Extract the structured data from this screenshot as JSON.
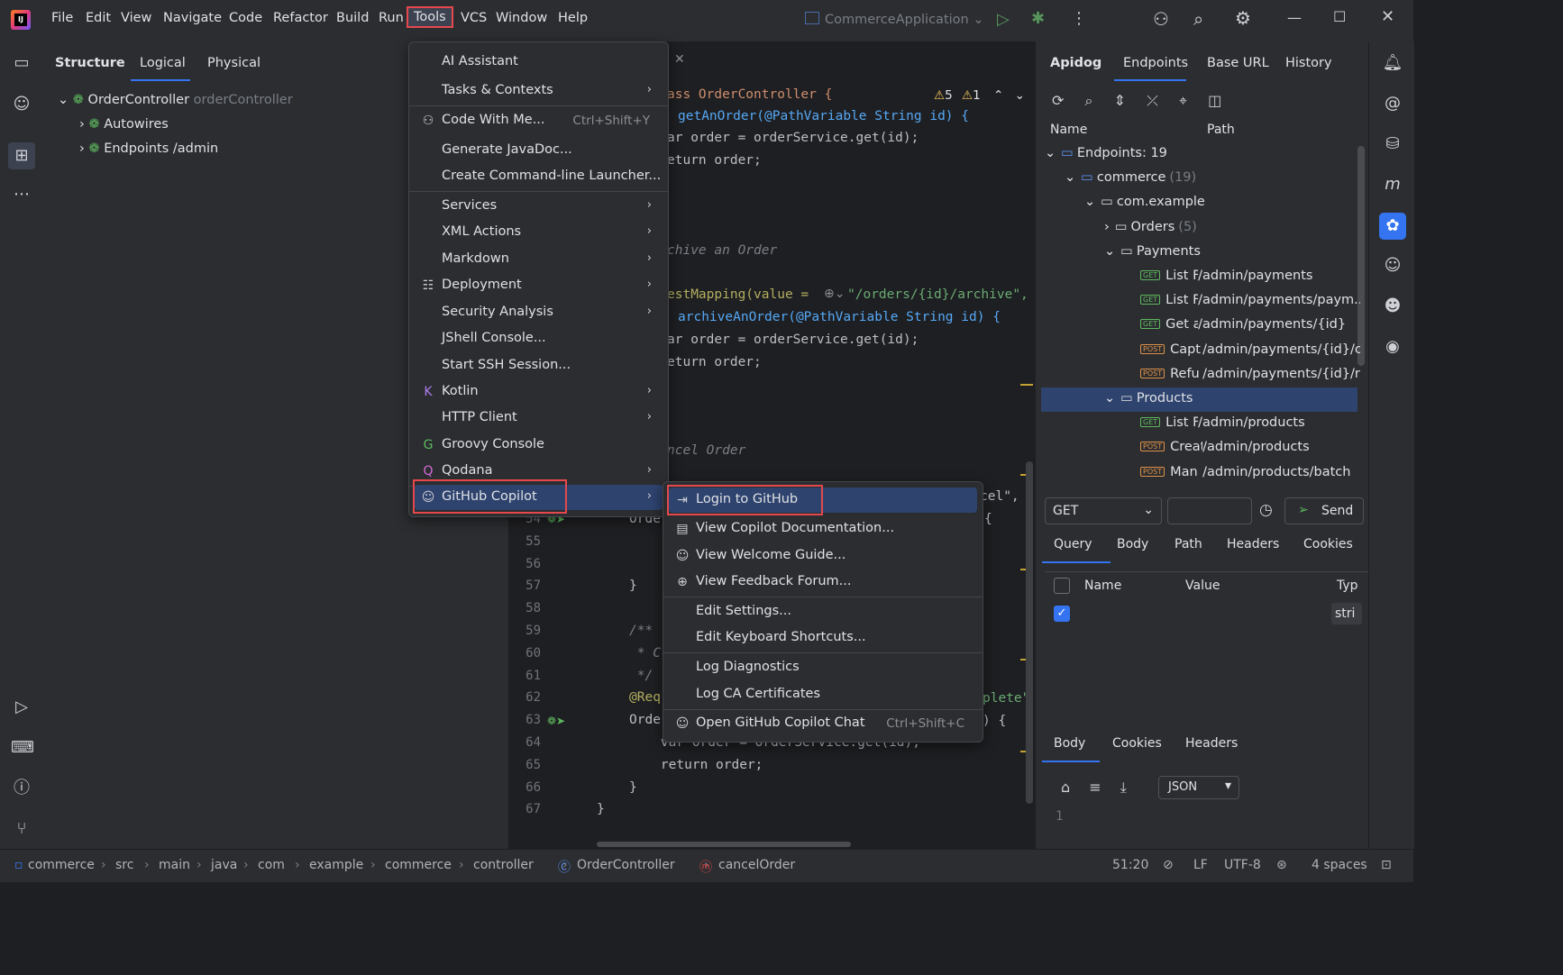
{
  "menubar": {
    "items": [
      "File",
      "Edit",
      "View",
      "Navigate",
      "Code",
      "Refactor",
      "Build",
      "Run",
      "Tools",
      "VCS",
      "Window",
      "Help"
    ],
    "run_config": "CommerceApplication"
  },
  "structure": {
    "tabs": [
      "Structure",
      "Logical",
      "Physical"
    ],
    "root": "OrderController",
    "root_hint": "orderController",
    "children": [
      "Autowires",
      "Endpoints /admin"
    ]
  },
  "editor": {
    "inspections": {
      "warnings": "5",
      "weak": "1"
    },
    "code_top": [
      "ass OrderController {",
      "getAnOrder(@PathVariable String id) {",
      "ar order = orderService.get(id);",
      "eturn order;",
      "chive an Order",
      "estMapping(value = ",
      "\"/orders/{id}/archive\",",
      "archiveAnOrder(@PathVariable String id) {",
      "ar order = orderService.get(id);",
      "eturn order;",
      "ncel Order"
    ],
    "lines": [
      {
        "n": "54",
        "text": "Orde"
      },
      {
        "n": "55",
        "text": ""
      },
      {
        "n": "56",
        "text": ""
      },
      {
        "n": "57",
        "text": "}"
      },
      {
        "n": "58",
        "text": ""
      },
      {
        "n": "59",
        "text": "/**"
      },
      {
        "n": "60",
        "text": " * C"
      },
      {
        "n": "61",
        "text": " */"
      },
      {
        "n": "62",
        "text": "@Req"
      },
      {
        "n": "63",
        "text": "Orde"
      },
      {
        "n": "64",
        "text": "    var order = orderService.get(id);"
      },
      {
        "n": "65",
        "text": "    return order;"
      },
      {
        "n": "66",
        "text": "}"
      },
      {
        "n": "67",
        "text": "}"
      }
    ],
    "right_fragments": [
      "cel\",",
      "plete\"",
      ") {",
      "{"
    ]
  },
  "tools_menu": {
    "items": [
      {
        "label": "AI Assistant"
      },
      {
        "label": "Tasks & Contexts",
        "sub": true
      },
      {
        "label": "Code With Me...",
        "shortcut": "Ctrl+Shift+Y"
      },
      {
        "label": "Generate JavaDoc..."
      },
      {
        "label": "Create Command-line Launcher..."
      },
      {
        "label": "Services",
        "sub": true
      },
      {
        "label": "XML Actions",
        "sub": true
      },
      {
        "label": "Markdown",
        "sub": true
      },
      {
        "label": "Deployment",
        "sub": true
      },
      {
        "label": "Security Analysis",
        "sub": true
      },
      {
        "label": "JShell Console..."
      },
      {
        "label": "Start SSH Session..."
      },
      {
        "label": "Kotlin",
        "sub": true
      },
      {
        "label": "HTTP Client",
        "sub": true
      },
      {
        "label": "Groovy Console"
      },
      {
        "label": "Qodana",
        "sub": true
      },
      {
        "label": "GitHub Copilot",
        "sub": true
      }
    ]
  },
  "copilot_menu": {
    "items": [
      {
        "label": "Login to GitHub"
      },
      {
        "label": "View Copilot Documentation..."
      },
      {
        "label": "View Welcome Guide..."
      },
      {
        "label": "View Feedback Forum..."
      },
      {
        "label": "Edit Settings..."
      },
      {
        "label": "Edit Keyboard Shortcuts..."
      },
      {
        "label": "Log Diagnostics"
      },
      {
        "label": "Log CA Certificates"
      },
      {
        "label": "Open GitHub Copilot Chat",
        "shortcut": "Ctrl+Shift+C"
      }
    ]
  },
  "apidog": {
    "tabs": [
      "Apidog",
      "Endpoints",
      "Base URL",
      "History"
    ],
    "columns": [
      "Name",
      "Path"
    ],
    "tree": [
      {
        "label": "Endpoints: 19"
      },
      {
        "label": "commerce",
        "count": "(19)"
      },
      {
        "label": "com.example"
      },
      {
        "label": "Orders",
        "count": "(5)"
      },
      {
        "label": "Payments"
      },
      {
        "method": "GET",
        "name": "List F",
        "path": "/admin/payments"
      },
      {
        "method": "GET",
        "name": "List F",
        "path": "/admin/payments/paym..."
      },
      {
        "method": "GET",
        "name": "Get a",
        "path": "/admin/payments/{id}"
      },
      {
        "method": "POST",
        "name": "Capt",
        "path": "/admin/payments/{id}/c..."
      },
      {
        "method": "POST",
        "name": "Refu",
        "path": "/admin/payments/{id}/r..."
      },
      {
        "label": "Products"
      },
      {
        "method": "GET",
        "name": "List F",
        "path": "/admin/products"
      },
      {
        "method": "POST",
        "name": "Creat",
        "path": "/admin/products"
      },
      {
        "method": "POST",
        "name": "Man",
        "path": "/admin/products/batch"
      }
    ],
    "request": {
      "method": "GET",
      "url": "",
      "send": "Send"
    },
    "req_tabs": [
      "Query",
      "Body",
      "Path",
      "Headers",
      "Cookies"
    ],
    "params_cols": [
      "Name",
      "Value",
      "Typ"
    ],
    "param_type": "stri",
    "resp_tabs": [
      "Body",
      "Cookies",
      "Headers"
    ],
    "resp_format": "JSON",
    "resp_line": "1"
  },
  "statusbar": {
    "breadcrumb": [
      "commerce",
      "src",
      "main",
      "java",
      "com",
      "example",
      "commerce",
      "controller",
      "OrderController",
      "cancelOrder"
    ],
    "position": "51:20",
    "line_sep": "LF",
    "encoding": "UTF-8",
    "indent": "4 spaces"
  }
}
